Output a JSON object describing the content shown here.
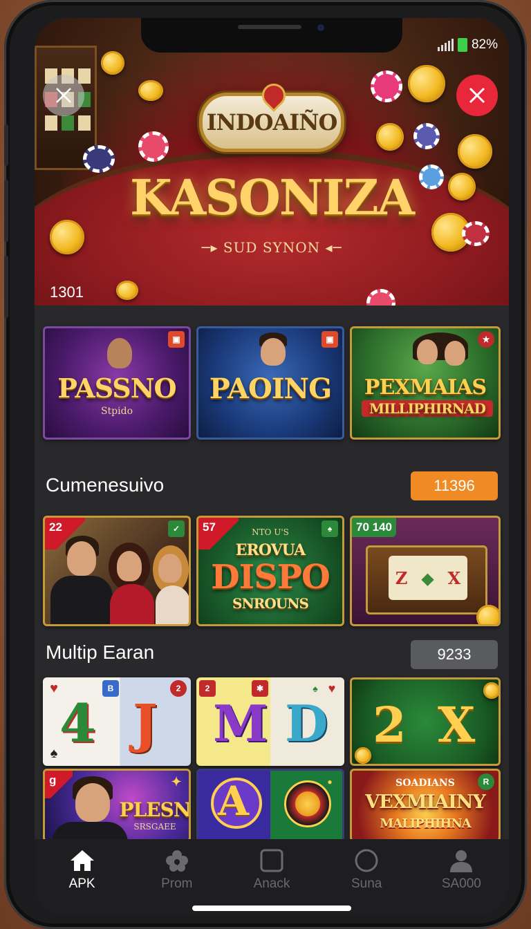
{
  "status_bar": {
    "battery_percent": "82%"
  },
  "hero": {
    "brand": "INDOAIÑO",
    "title": "KASONIZA",
    "subtitle": "SUD SYNON",
    "counter": "1301"
  },
  "row1": [
    {
      "title": "PASSNO",
      "subtitle": "Stpido"
    },
    {
      "title": "PAOING"
    },
    {
      "title_line1": "PEXMAIAS",
      "title_line2": "MILLIPHIRNAD"
    }
  ],
  "section1": {
    "title": "Cumenesuivo",
    "value": "11396"
  },
  "row2": [
    {
      "corner": "22"
    },
    {
      "corner": "57",
      "top_text": "NTO U'S",
      "line1": "EROVUA",
      "line2": "DISPO",
      "line3": "SNROUNS"
    },
    {
      "corner": "70 140"
    }
  ],
  "section2": {
    "title": "Multip Earan",
    "value": "9233"
  },
  "row3": [
    {
      "left": "4",
      "right": "J"
    },
    {
      "left": "M",
      "right": "D"
    },
    {
      "left": "2",
      "right": "X"
    }
  ],
  "row4": [
    {
      "title": "PLESN",
      "sub": "SRSGAEE"
    },
    {
      "glyph": "A"
    },
    {
      "top": "SOADIANS",
      "line1": "VEXMIAINY",
      "line2": "MALIPHIHNA"
    }
  ],
  "tabbar": [
    {
      "label": "APK",
      "icon": "home-icon"
    },
    {
      "label": "Prom",
      "icon": "flower-icon"
    },
    {
      "label": "Anack",
      "icon": "square-icon"
    },
    {
      "label": "Suna",
      "icon": "circle-icon"
    },
    {
      "label": "SА000",
      "icon": "user-icon"
    }
  ],
  "colors": {
    "accent": "#ef8a24",
    "close_red": "#e8283a",
    "tile_border": "#c59a3a"
  }
}
